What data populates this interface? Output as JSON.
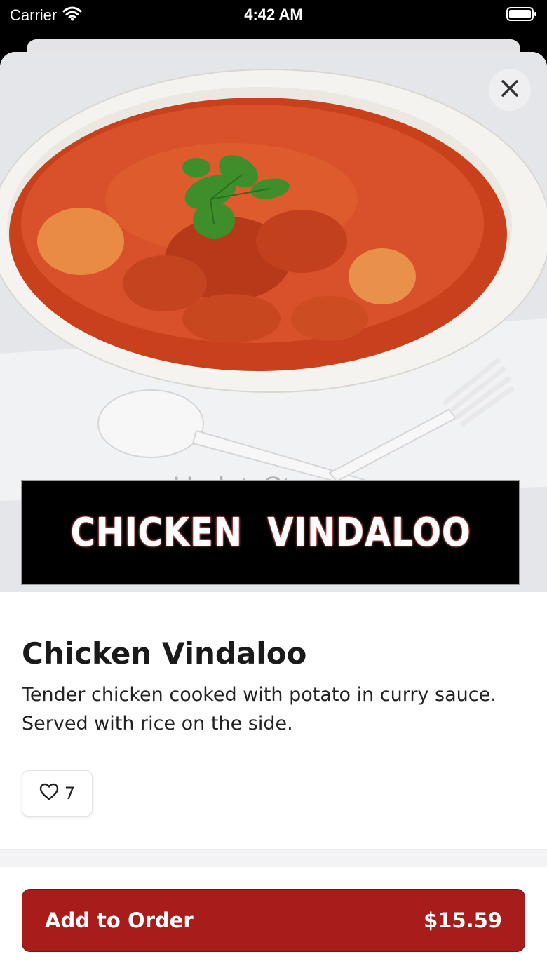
{
  "status_bar": {
    "carrier": "Carrier",
    "time": "4:42 AM"
  },
  "hero": {
    "banner_text": "CHICKEN  VINDALOO",
    "watermark": "UpdateStar.com"
  },
  "item": {
    "title": "Chicken Vindaloo",
    "description": "Tender chicken cooked with potato in curry sauce. Served with rice on the side.",
    "likes": "7"
  },
  "footer": {
    "add_label": "Add to Order",
    "price": "$15.59"
  },
  "colors": {
    "accent": "#a81c1c",
    "curry": "#d9512a"
  },
  "icons": {
    "close": "close-icon",
    "like": "heart-icon",
    "wifi": "wifi-icon",
    "battery": "battery-icon"
  }
}
